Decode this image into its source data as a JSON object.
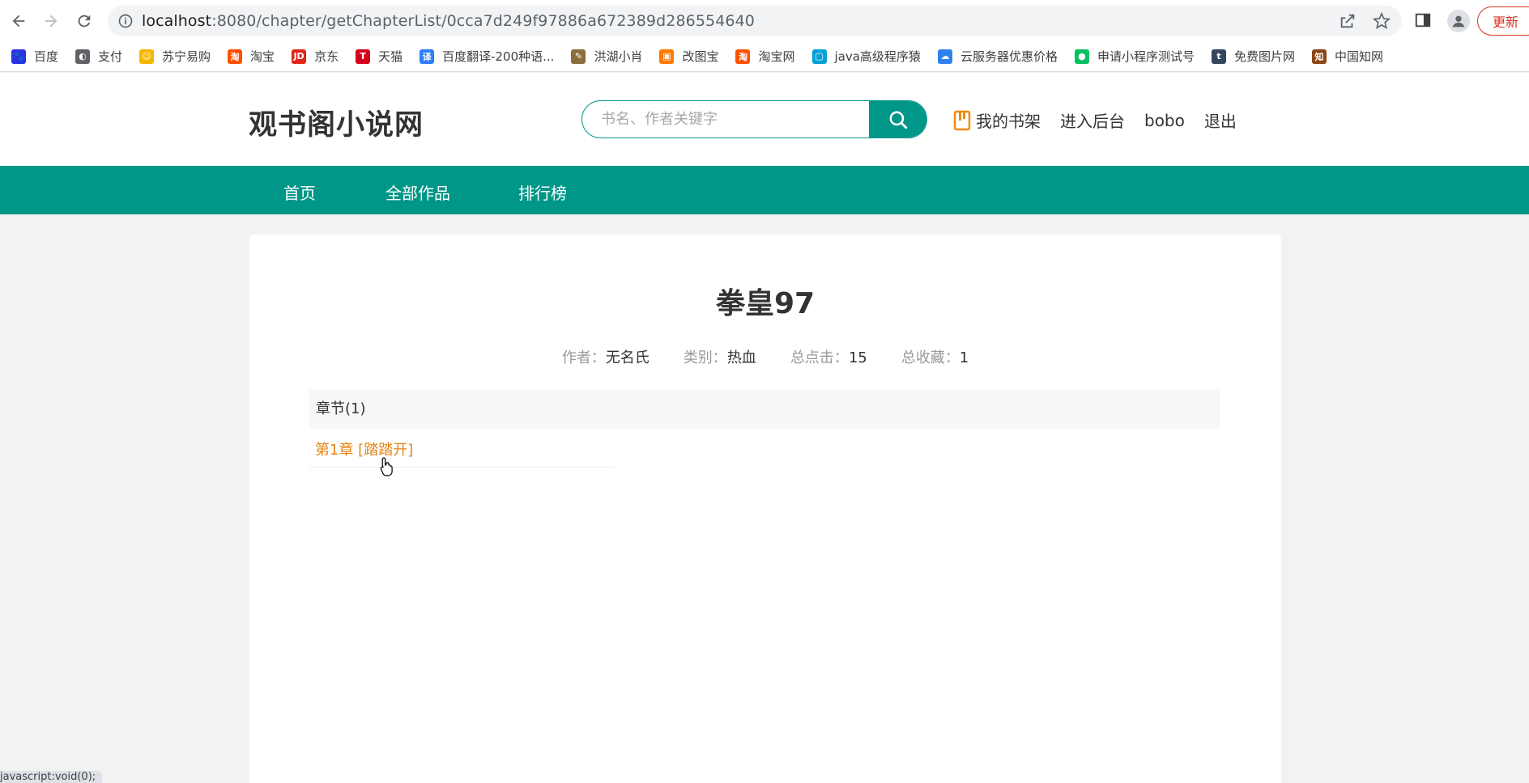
{
  "browser": {
    "url_host": "localhost",
    "url_rest": ":8080/chapter/getChapterList/0cca7d249f97886a672389d286554640",
    "update_label": "更新",
    "bookmarks": [
      {
        "label": "百度",
        "icon": "baidu-icon",
        "color": "#2932e1",
        "glyph": "🐾"
      },
      {
        "label": "支付",
        "icon": "globe-icon",
        "color": "#5f6368",
        "glyph": "◐"
      },
      {
        "label": "苏宁易购",
        "icon": "suning-icon",
        "color": "#f5b700",
        "glyph": "☺"
      },
      {
        "label": "淘宝",
        "icon": "taobao-icon",
        "color": "#ff5000",
        "glyph": "淘"
      },
      {
        "label": "京东",
        "icon": "jd-icon",
        "color": "#e1251b",
        "glyph": "JD"
      },
      {
        "label": "天猫",
        "icon": "tmall-icon",
        "color": "#d5001c",
        "glyph": "T"
      },
      {
        "label": "百度翻译-200种语...",
        "icon": "translate-icon",
        "color": "#2d7ff9",
        "glyph": "译"
      },
      {
        "label": "洪湖小肖",
        "icon": "feather-icon",
        "color": "#8a6d3b",
        "glyph": "✎"
      },
      {
        "label": "改图宝",
        "icon": "gaitubao-icon",
        "color": "#ff7a00",
        "glyph": "▣"
      },
      {
        "label": "淘宝网",
        "icon": "taobao-icon",
        "color": "#ff5000",
        "glyph": "淘"
      },
      {
        "label": "java高级程序猿",
        "icon": "bilibili-icon",
        "color": "#00a1d6",
        "glyph": "▢"
      },
      {
        "label": "云服务器优惠价格",
        "icon": "cloud-icon",
        "color": "#2f80ed",
        "glyph": "☁"
      },
      {
        "label": "申请小程序测试号",
        "icon": "wechat-icon",
        "color": "#07c160",
        "glyph": "●"
      },
      {
        "label": "免费图片网",
        "icon": "tumblr-icon",
        "color": "#35465c",
        "glyph": "t"
      },
      {
        "label": "中国知网",
        "icon": "cnki-icon",
        "color": "#8b4513",
        "glyph": "知"
      }
    ],
    "status_text": "javascript:void(0);"
  },
  "site": {
    "logo": "观书阁小说网",
    "search_placeholder": "书名、作者关键字",
    "shelf_label": "我的书架",
    "admin_label": "进入后台",
    "username": "bobo",
    "logout_label": "退出",
    "nav": [
      "首页",
      "全部作品",
      "排行榜"
    ],
    "brand_color": "#009688",
    "link_color": "#e88416"
  },
  "book": {
    "title": "拳皇97",
    "author_label": "作者：",
    "author": "无名氏",
    "category_label": "类别：",
    "category": "热血",
    "clicks_label": "总点击：",
    "clicks": "15",
    "favorites_label": "总收藏：",
    "favorites": "1",
    "chapters_header": "章节(1)",
    "chapters": [
      "第1章 [踏踏开]"
    ]
  }
}
